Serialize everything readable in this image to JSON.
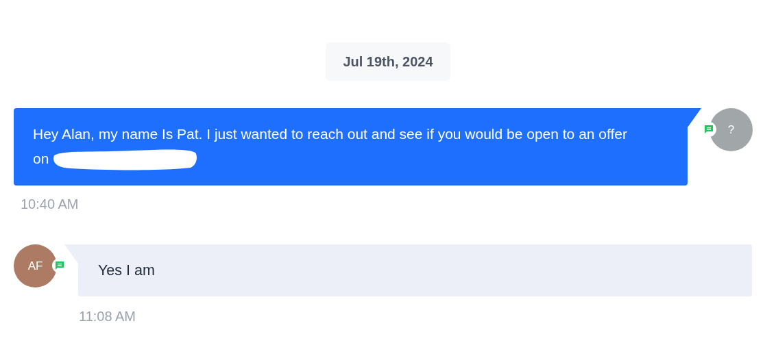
{
  "date_divider": "Jul 19th, 2024",
  "messages": [
    {
      "kind": "outgoing",
      "text": "Hey Alan, my name Is Pat. I just wanted to reach out and see if you would be open to an offer on",
      "redacted": true,
      "avatar": "?",
      "color": "#a1a6a8",
      "time": "10:40 AM"
    },
    {
      "kind": "incoming",
      "text": "Yes I am",
      "redacted": false,
      "avatar": "AF",
      "color": "#ad7b64",
      "time": "11:08 AM"
    }
  ]
}
